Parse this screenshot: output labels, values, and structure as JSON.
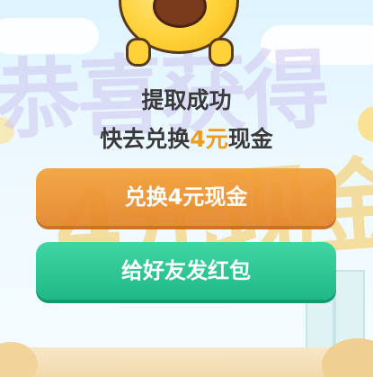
{
  "background": {
    "letters_top": "恭喜获得",
    "letters_big": "4元现金"
  },
  "dialog": {
    "title": "提取成功",
    "subtitle_prefix": "快去兑换",
    "subtitle_amount": "4元",
    "subtitle_suffix": "现金",
    "amount_color": "#f29a1b"
  },
  "buttons": {
    "exchange_label": "兑换4元现金",
    "share_label": "给好友发红包"
  },
  "colors": {
    "exchange": "#e5852a",
    "share": "#20b887",
    "text": "#3a3a3a"
  }
}
